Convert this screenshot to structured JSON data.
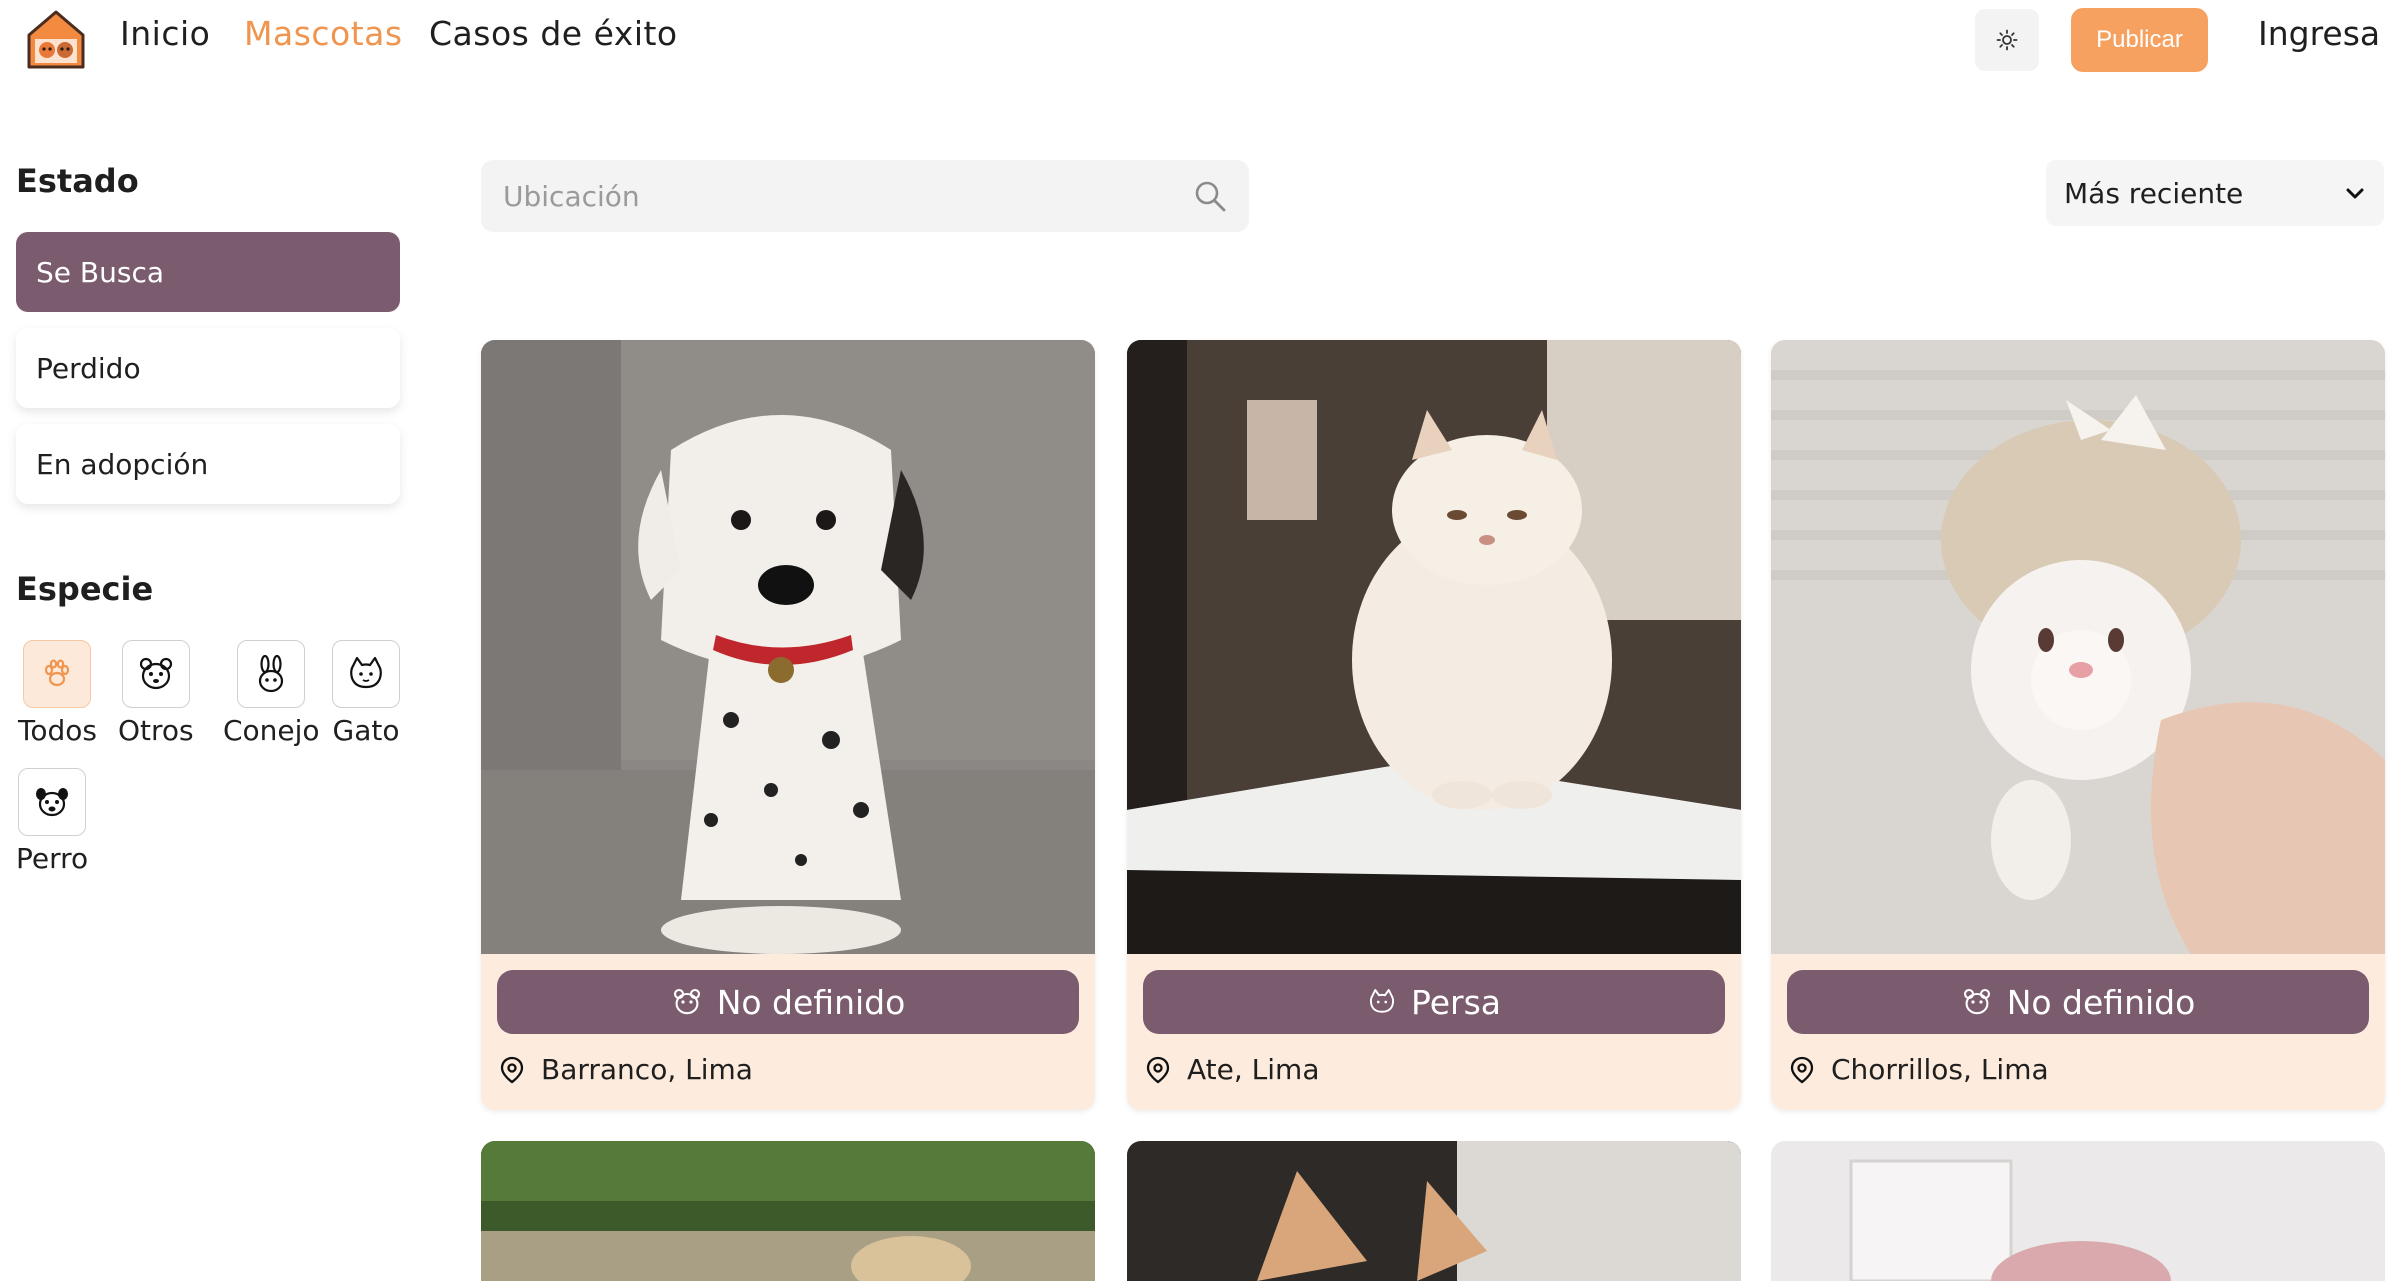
{
  "header": {
    "logo_icon": "pet-house-logo-icon",
    "nav": [
      {
        "label": "Inicio",
        "active": false
      },
      {
        "label": "Mascotas",
        "active": true
      },
      {
        "label": "Casos de éxito",
        "active": false
      }
    ],
    "theme_icon": "sun-icon",
    "publish_label": "Publicar",
    "login_label": "Ingresa"
  },
  "sidebar": {
    "state_title": "Estado",
    "states": [
      {
        "label": "Se Busca",
        "active": true
      },
      {
        "label": "Perdido",
        "active": false
      },
      {
        "label": "En adopción",
        "active": false
      }
    ],
    "species_title": "Especie",
    "species": [
      {
        "label": "Todos",
        "icon": "paw-icon",
        "active": true
      },
      {
        "label": "Otros",
        "icon": "hamster-icon",
        "active": false
      },
      {
        "label": "Conejo",
        "icon": "rabbit-icon",
        "active": false
      },
      {
        "label": "Gato",
        "icon": "cat-icon",
        "active": false
      },
      {
        "label": "Perro",
        "icon": "dog-icon",
        "active": false
      }
    ]
  },
  "search": {
    "placeholder": "Ubicación",
    "value": ""
  },
  "sort": {
    "selected": "Más reciente"
  },
  "pets": [
    {
      "breed": "No definido",
      "breed_icon": "hamster-icon",
      "location": "Barranco, Lima"
    },
    {
      "breed": "Persa",
      "breed_icon": "cat-icon",
      "location": "Ate, Lima"
    },
    {
      "breed": "No definido",
      "breed_icon": "hamster-icon",
      "location": "Chorrillos, Lima"
    }
  ],
  "colors": {
    "accent": "#f7a160",
    "active_nav": "#f0954f",
    "card_bg": "#fdebdd",
    "chip_bg": "#7b5b6e"
  }
}
